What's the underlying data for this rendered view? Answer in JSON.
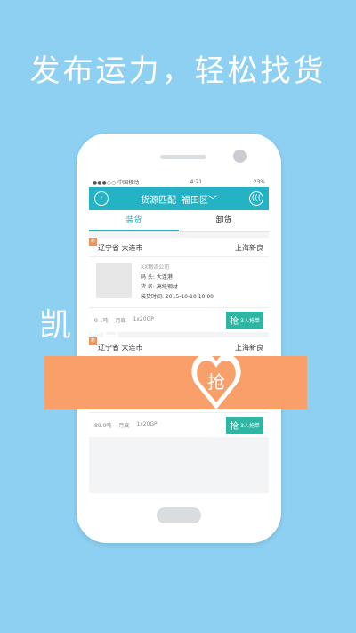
{
  "headline": "发布运力，轻松找货",
  "overlay_text": "凯 站",
  "heart_char": "抢",
  "phone": {
    "status": {
      "carrier": "●●●○○ 中国移动 ",
      "time": "4:21",
      "battery": "23%"
    },
    "nav": {
      "title": "货源匹配",
      "district": "福田区",
      "back_icon": "‹",
      "right_icon": "((("
    },
    "tabs": [
      "装货",
      "卸货"
    ],
    "cards": [
      {
        "tag": "新",
        "from": "辽宁省  大连市",
        "to": "上海新良",
        "company": "XX物流公司",
        "lines": [
          "码    头:  大连港",
          "货    名:  高级钢材",
          "装货时间:  2015-10-10 10:00"
        ],
        "foot": [
          "9.1吨",
          "月底",
          "1x20GP"
        ],
        "grab": "抢",
        "grab_count": "3人抢单"
      },
      {
        "tag": "新",
        "from": "辽宁省  大连市",
        "to": "上海新良",
        "company": "",
        "lines": [],
        "foot": [
          "89.0吨",
          "月底",
          "1x20GP"
        ],
        "grab": "抢",
        "grab_count": "3人抢单"
      }
    ]
  }
}
